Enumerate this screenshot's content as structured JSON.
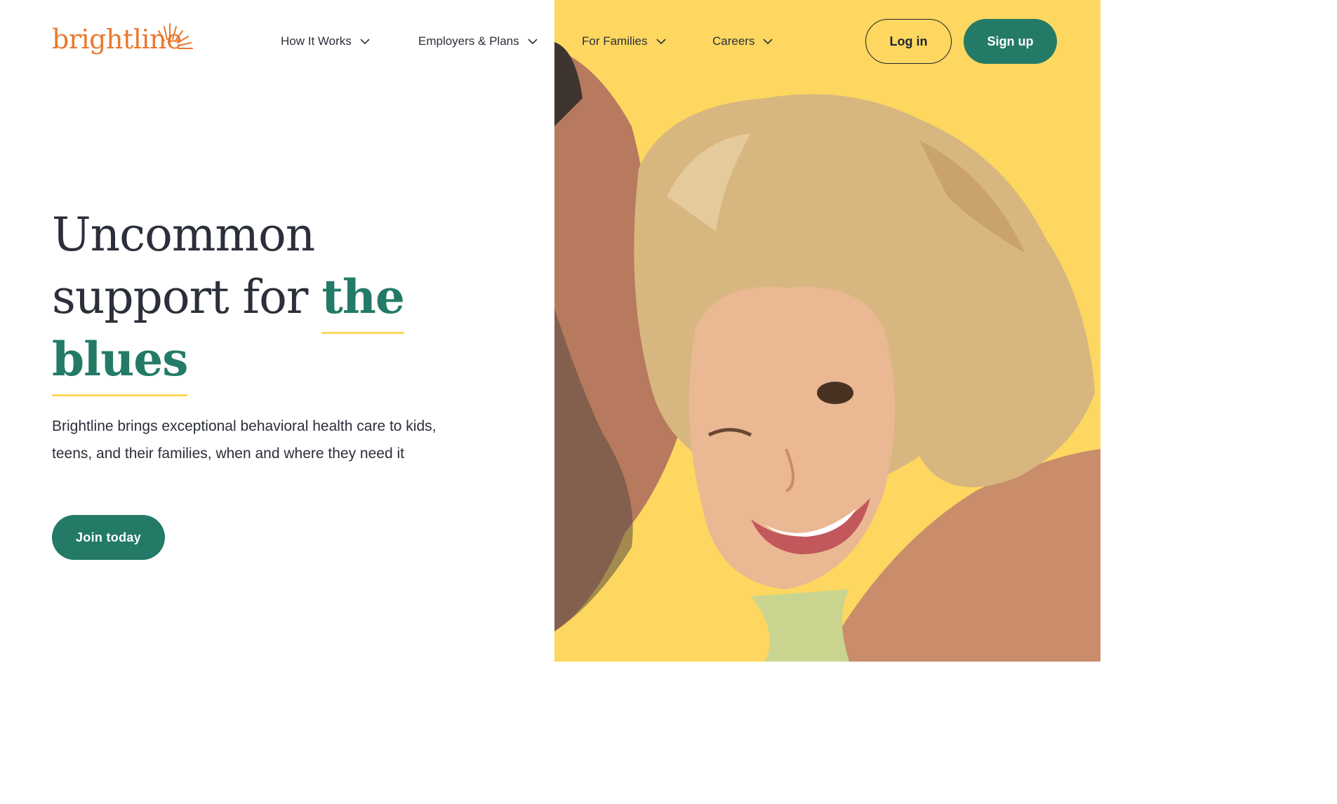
{
  "brand": {
    "logo_text": "brightline",
    "colors": {
      "orange": "#e9782f",
      "green": "#237a67",
      "yellow": "#fdd75f",
      "text": "#2b2f3a"
    }
  },
  "nav": {
    "items": [
      {
        "label": "How It Works",
        "icon": "chevron-down-icon"
      },
      {
        "label": "Employers & Plans",
        "icon": "chevron-down-icon"
      },
      {
        "label": "For Families",
        "icon": "chevron-down-icon"
      },
      {
        "label": "Careers",
        "icon": "chevron-down-icon"
      }
    ],
    "login_label": "Log in",
    "signup_label": "Sign up"
  },
  "hero": {
    "headline_line1": "Uncommon",
    "headline_line2_plain": "support for ",
    "headline_line2_accent": "the",
    "headline_line3_accent": "blues",
    "subtext": "Brightline brings exceptional behavioral health care to kids, teens, and their families, when and where they need it",
    "cta_label": "Join today",
    "image": "smiling-child-with-parent-photo"
  }
}
